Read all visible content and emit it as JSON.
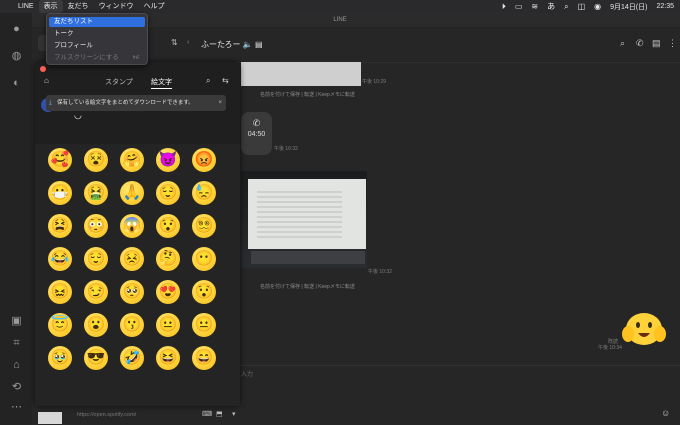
{
  "menubar": {
    "apple": "",
    "items": [
      "LINE",
      "表示",
      "友だち",
      "ウィンドウ",
      "ヘルプ"
    ],
    "right_date": "9月14日(日)",
    "right_time": "22:35"
  },
  "window": {
    "title": "LINE"
  },
  "view_menu": {
    "items": [
      {
        "label": "友だちリスト",
        "selected": true,
        "disabled": false
      },
      {
        "label": "トーク",
        "selected": false,
        "disabled": false
      },
      {
        "label": "プロフィール",
        "selected": false,
        "disabled": false
      },
      {
        "label": "フルスクリーンにする",
        "selected": false,
        "disabled": true,
        "shortcut": "fnF"
      }
    ]
  },
  "chat": {
    "name": "ふーたろー",
    "meta": [
      {
        "time": "午後 10:29"
      },
      {
        "time": "午後 10:32"
      },
      {
        "time": "午後 10:32"
      },
      {
        "read": "既読",
        "time": "午後 10:34"
      }
    ],
    "actions": [
      "名前を付けて保存 | 転送 | Keepメモに転送",
      "名前を付けて保存 | 転送 | Keepメモに転送"
    ],
    "call_duration": "04:50",
    "input_hint": "入力",
    "link_preview": "https://open.spotify.com/"
  },
  "picker": {
    "tabs": {
      "stamp": "スタンプ",
      "emoji": "絵文字"
    },
    "notice": "保有している絵文字をまとめてダウンロードできます。",
    "emoji_rows": [
      [
        "🥰",
        "😵",
        "🤗",
        "😈",
        "😡"
      ],
      [
        "😷",
        "🤮",
        "🙏",
        "😌",
        "😓"
      ],
      [
        "😫",
        "😳",
        "😱",
        "😯",
        "😵‍💫"
      ],
      [
        "😂",
        "😌",
        "😣",
        "🤔",
        "😶"
      ],
      [
        "😖",
        "😏",
        "🥺",
        "😍",
        "😯"
      ],
      [
        "😇",
        "😮",
        "😗",
        "😐",
        "😐"
      ],
      [
        "🥹",
        "😎",
        "🤣",
        "😆",
        "😄"
      ]
    ]
  },
  "colors": {
    "accent": "#2f6fe0",
    "close": "#ff5f57",
    "emoji": "#ffd23a"
  }
}
